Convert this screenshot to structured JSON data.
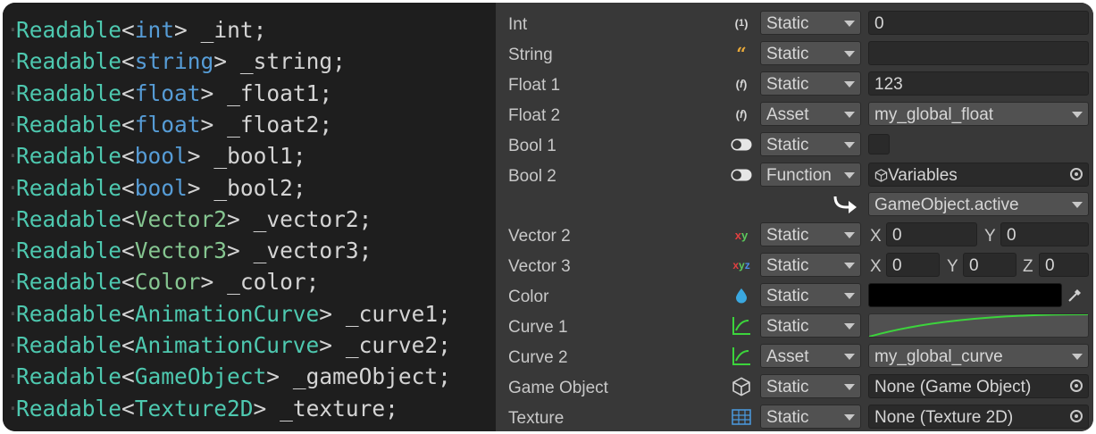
{
  "code": {
    "lines": [
      {
        "type": "Readable",
        "generic": "int",
        "name": "_int"
      },
      {
        "type": "Readable",
        "generic": "string",
        "name": "_string"
      },
      {
        "type": "Readable",
        "generic": "float",
        "name": "_float1"
      },
      {
        "type": "Readable",
        "generic": "float",
        "name": "_float2"
      },
      {
        "type": "Readable",
        "generic": "bool",
        "name": "_bool1"
      },
      {
        "type": "Readable",
        "generic": "bool",
        "name": "_bool2"
      },
      {
        "type": "Readable",
        "generic": "Vector2",
        "name": "_vector2"
      },
      {
        "type": "Readable",
        "generic": "Vector3",
        "name": "_vector3"
      },
      {
        "type": "Readable",
        "generic": "Color",
        "name": "_color"
      },
      {
        "type": "Readable",
        "generic": "AnimationCurve",
        "name": "_curve1"
      },
      {
        "type": "Readable",
        "generic": "AnimationCurve",
        "name": "_curve2"
      },
      {
        "type": "Readable",
        "generic": "GameObject",
        "name": "_gameObject"
      },
      {
        "type": "Readable",
        "generic": "Texture2D",
        "name": "_texture"
      }
    ],
    "lt": "<",
    "gt": ">",
    "semicolon": ";",
    "colors": {
      "type": "#4ec9b0",
      "builtin": "#569cd6",
      "struct": "#86c691",
      "text": "#d4d4d4"
    }
  },
  "inspector": {
    "int": {
      "label": "Int",
      "icon": "int-type-icon",
      "mode": "Static",
      "value": "0"
    },
    "string": {
      "label": "String",
      "icon": "string-type-icon",
      "mode": "Static",
      "value": ""
    },
    "float1": {
      "label": "Float 1",
      "icon": "float-type-icon",
      "mode": "Static",
      "value": "123"
    },
    "float2": {
      "label": "Float 2",
      "icon": "float-type-icon",
      "mode": "Asset",
      "value": "my_global_float"
    },
    "bool1": {
      "label": "Bool 1",
      "icon": "toggle-icon",
      "mode": "Static",
      "checked": false
    },
    "bool2": {
      "label": "Bool 2",
      "icon": "toggle-icon",
      "mode": "Function",
      "object": "Variables",
      "member": "GameObject.active"
    },
    "vector2": {
      "label": "Vector 2",
      "icon": "xy-icon",
      "mode": "Static",
      "x_label": "X",
      "x": "0",
      "y_label": "Y",
      "y": "0"
    },
    "vector3": {
      "label": "Vector 3",
      "icon": "xyz-icon",
      "mode": "Static",
      "x_label": "X",
      "x": "0",
      "y_label": "Y",
      "y": "0",
      "z_label": "Z",
      "z": "0"
    },
    "color": {
      "label": "Color",
      "icon": "color-drop-icon",
      "mode": "Static",
      "value": "#000000"
    },
    "curve1": {
      "label": "Curve 1",
      "icon": "curve-icon",
      "mode": "Static",
      "curve_color": "#3cd43c"
    },
    "curve2": {
      "label": "Curve 2",
      "icon": "curve-icon",
      "mode": "Asset",
      "value": "my_global_curve"
    },
    "gameobject": {
      "label": "Game Object",
      "icon": "cube-icon",
      "mode": "Static",
      "value": "None (Game Object)"
    },
    "texture": {
      "label": "Texture",
      "icon": "texture-icon",
      "mode": "Static",
      "value": "None (Texture 2D)"
    }
  }
}
